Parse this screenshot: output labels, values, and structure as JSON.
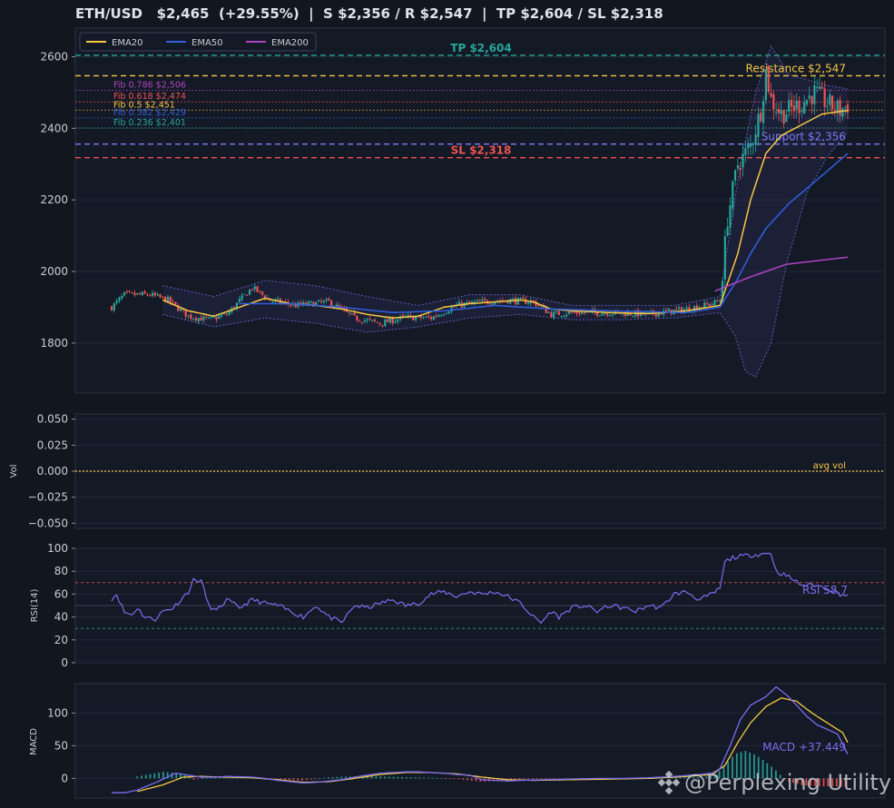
{
  "title": "ETH/USD   $2,465  (+29.55%)  |  S $2,356 / R $2,547  |  TP $2,604 / SL $2,318",
  "watermark": "@Perplexing Utility",
  "colors": {
    "bg": "#12161f",
    "panel": "#141926",
    "grid": "#222939",
    "up": "#26a69a",
    "down": "#ef5350",
    "ema20": "#f5c842",
    "ema50": "#2f5fe0",
    "ema200": "#b044c0",
    "rsi": "#7b6cf0",
    "macd": "#7b6cf0",
    "signal": "#f5c842",
    "text": "#c9ccd2"
  },
  "chart_data": [
    {
      "type": "candlestick",
      "panel": "price",
      "ylim": [
        1660,
        2680
      ],
      "yticks": [
        1800,
        2000,
        2200,
        2400,
        2600
      ],
      "legend": {
        "placement": "top-left",
        "entries": [
          "EMA20",
          "EMA50",
          "EMA200"
        ]
      },
      "levels": [
        {
          "label": "TP $2,604",
          "value": 2604,
          "color": "#26a69a",
          "style": "dash",
          "label_pos": "center"
        },
        {
          "label": "Resistance $2,547",
          "value": 2547,
          "color": "#f5c842",
          "style": "dash",
          "label_pos": "right"
        },
        {
          "label": "Support $2,356",
          "value": 2356,
          "color": "#7b7cf5",
          "style": "dash",
          "label_pos": "right"
        },
        {
          "label": "SL $2,318",
          "value": 2318,
          "color": "#ef5350",
          "style": "dash",
          "label_pos": "center"
        }
      ],
      "fib": [
        {
          "label": "Fib 0.786 $2,506",
          "value": 2506,
          "color": "#b044c0"
        },
        {
          "label": "Fib 0.618 $2,474",
          "value": 2474,
          "color": "#ef5350"
        },
        {
          "label": "Fib 0.5 $2,451",
          "value": 2451,
          "color": "#f5c842"
        },
        {
          "label": "Fib 0.382 $2,429",
          "value": 2429,
          "color": "#2f5fe0"
        },
        {
          "label": "Fib 0.236 $2,401",
          "value": 2401,
          "color": "#26a69a"
        }
      ],
      "close_anchors": [
        [
          0,
          1900
        ],
        [
          5,
          1935
        ],
        [
          15,
          1935
        ],
        [
          22,
          1920
        ],
        [
          30,
          1875
        ],
        [
          38,
          1865
        ],
        [
          45,
          1880
        ],
        [
          55,
          1955
        ],
        [
          62,
          1920
        ],
        [
          72,
          1905
        ],
        [
          85,
          1915
        ],
        [
          95,
          1870
        ],
        [
          105,
          1855
        ],
        [
          115,
          1872
        ],
        [
          125,
          1870
        ],
        [
          135,
          1905
        ],
        [
          145,
          1915
        ],
        [
          155,
          1920
        ],
        [
          165,
          1915
        ],
        [
          172,
          1880
        ],
        [
          180,
          1885
        ],
        [
          195,
          1885
        ],
        [
          210,
          1880
        ],
        [
          225,
          1895
        ],
        [
          235,
          1910
        ],
        [
          238,
          1920
        ],
        [
          241,
          2150
        ],
        [
          245,
          2300
        ],
        [
          250,
          2350
        ],
        [
          254,
          2450
        ],
        [
          256,
          2560
        ],
        [
          258,
          2480
        ],
        [
          262,
          2440
        ],
        [
          270,
          2470
        ],
        [
          275,
          2500
        ],
        [
          280,
          2470
        ],
        [
          285,
          2450
        ],
        [
          288,
          2465
        ]
      ],
      "ema20_anchors": [
        [
          20,
          1920
        ],
        [
          30,
          1890
        ],
        [
          40,
          1875
        ],
        [
          50,
          1900
        ],
        [
          60,
          1925
        ],
        [
          70,
          1910
        ],
        [
          80,
          1905
        ],
        [
          90,
          1895
        ],
        [
          100,
          1880
        ],
        [
          110,
          1870
        ],
        [
          120,
          1875
        ],
        [
          130,
          1900
        ],
        [
          140,
          1910
        ],
        [
          150,
          1915
        ],
        [
          160,
          1920
        ],
        [
          165,
          1915
        ],
        [
          172,
          1895
        ],
        [
          180,
          1890
        ],
        [
          195,
          1885
        ],
        [
          210,
          1882
        ],
        [
          225,
          1890
        ],
        [
          238,
          1905
        ],
        [
          245,
          2050
        ],
        [
          250,
          2200
        ],
        [
          256,
          2330
        ],
        [
          262,
          2380
        ],
        [
          270,
          2410
        ],
        [
          278,
          2440
        ],
        [
          288,
          2450
        ]
      ],
      "ema50_anchors": [
        [
          50,
          1910
        ],
        [
          70,
          1910
        ],
        [
          90,
          1900
        ],
        [
          110,
          1885
        ],
        [
          130,
          1890
        ],
        [
          150,
          1905
        ],
        [
          172,
          1895
        ],
        [
          195,
          1890
        ],
        [
          225,
          1885
        ],
        [
          238,
          1900
        ],
        [
          245,
          1980
        ],
        [
          250,
          2050
        ],
        [
          256,
          2120
        ],
        [
          265,
          2190
        ],
        [
          275,
          2250
        ],
        [
          288,
          2330
        ]
      ],
      "ema200_anchors": [
        [
          236,
          1945
        ],
        [
          250,
          1985
        ],
        [
          264,
          2020
        ],
        [
          288,
          2040
        ]
      ],
      "bb_upper_anchors": [
        [
          20,
          1960
        ],
        [
          40,
          1930
        ],
        [
          60,
          1975
        ],
        [
          80,
          1960
        ],
        [
          100,
          1930
        ],
        [
          120,
          1905
        ],
        [
          140,
          1935
        ],
        [
          160,
          1935
        ],
        [
          180,
          1905
        ],
        [
          200,
          1905
        ],
        [
          220,
          1905
        ],
        [
          238,
          1930
        ],
        [
          246,
          2300
        ],
        [
          252,
          2500
        ],
        [
          258,
          2630
        ],
        [
          265,
          2550
        ],
        [
          280,
          2520
        ],
        [
          288,
          2510
        ]
      ],
      "bb_lower_anchors": [
        [
          20,
          1880
        ],
        [
          40,
          1845
        ],
        [
          60,
          1870
        ],
        [
          80,
          1855
        ],
        [
          100,
          1830
        ],
        [
          120,
          1845
        ],
        [
          140,
          1870
        ],
        [
          160,
          1880
        ],
        [
          180,
          1865
        ],
        [
          200,
          1865
        ],
        [
          220,
          1870
        ],
        [
          238,
          1885
        ],
        [
          244,
          1820
        ],
        [
          248,
          1720
        ],
        [
          252,
          1705
        ],
        [
          258,
          1800
        ],
        [
          264,
          2020
        ],
        [
          272,
          2220
        ],
        [
          280,
          2320
        ],
        [
          288,
          2390
        ]
      ]
    },
    {
      "type": "bar",
      "panel": "volume",
      "ylabel": "Vol",
      "ylim": [
        -0.055,
        0.055
      ],
      "yticks": [
        0.05,
        0.025,
        0,
        -0.025,
        -0.05
      ],
      "ytick_labels": [
        "0.050",
        "0.025",
        "0.000",
        "−0.025",
        "−0.050"
      ],
      "avg_label": "avg vol",
      "avg_value": 0
    },
    {
      "type": "line",
      "panel": "rsi",
      "ylabel": "RSI(14)",
      "ylim": [
        0,
        100
      ],
      "yticks": [
        0,
        20,
        40,
        60,
        80,
        100
      ],
      "overbought": 70,
      "oversold": 30,
      "mid": 50,
      "last_label": "RSI 58.7",
      "anchors": [
        [
          0,
          56
        ],
        [
          2,
          60
        ],
        [
          5,
          44
        ],
        [
          8,
          42
        ],
        [
          10,
          48
        ],
        [
          13,
          40
        ],
        [
          17,
          38
        ],
        [
          20,
          45
        ],
        [
          24,
          48
        ],
        [
          27,
          55
        ],
        [
          30,
          62
        ],
        [
          32,
          72
        ],
        [
          35,
          72
        ],
        [
          38,
          50
        ],
        [
          41,
          45
        ],
        [
          45,
          55
        ],
        [
          50,
          48
        ],
        [
          55,
          55
        ],
        [
          60,
          52
        ],
        [
          65,
          50
        ],
        [
          70,
          45
        ],
        [
          75,
          40
        ],
        [
          80,
          50
        ],
        [
          85,
          40
        ],
        [
          90,
          35
        ],
        [
          95,
          50
        ],
        [
          100,
          48
        ],
        [
          105,
          52
        ],
        [
          110,
          55
        ],
        [
          115,
          50
        ],
        [
          120,
          52
        ],
        [
          125,
          60
        ],
        [
          130,
          62
        ],
        [
          135,
          58
        ],
        [
          140,
          62
        ],
        [
          145,
          60
        ],
        [
          150,
          62
        ],
        [
          155,
          58
        ],
        [
          160,
          52
        ],
        [
          165,
          40
        ],
        [
          168,
          35
        ],
        [
          172,
          45
        ],
        [
          175,
          40
        ],
        [
          180,
          48
        ],
        [
          185,
          50
        ],
        [
          190,
          45
        ],
        [
          195,
          50
        ],
        [
          200,
          48
        ],
        [
          205,
          45
        ],
        [
          210,
          50
        ],
        [
          215,
          48
        ],
        [
          220,
          60
        ],
        [
          225,
          62
        ],
        [
          230,
          55
        ],
        [
          235,
          60
        ],
        [
          238,
          65
        ],
        [
          240,
          88
        ],
        [
          243,
          92
        ],
        [
          250,
          94
        ],
        [
          258,
          96
        ],
        [
          260,
          80
        ],
        [
          265,
          75
        ],
        [
          270,
          68
        ],
        [
          275,
          68
        ],
        [
          280,
          65
        ],
        [
          285,
          60
        ],
        [
          288,
          58.7
        ]
      ]
    },
    {
      "type": "line",
      "panel": "macd",
      "ylabel": "MACD",
      "ylim": [
        -30,
        145
      ],
      "yticks": [
        0,
        50,
        100
      ],
      "last_label": "MACD +37.449",
      "macd_anchors": [
        [
          0,
          -22
        ],
        [
          5,
          -22
        ],
        [
          10,
          -18
        ],
        [
          18,
          -5
        ],
        [
          25,
          8
        ],
        [
          30,
          5
        ],
        [
          35,
          2
        ],
        [
          40,
          2
        ],
        [
          45,
          3
        ],
        [
          55,
          2
        ],
        [
          60,
          0
        ],
        [
          65,
          -3
        ],
        [
          70,
          -5
        ],
        [
          75,
          -7
        ],
        [
          80,
          -6
        ],
        [
          85,
          -4
        ],
        [
          90,
          -2
        ],
        [
          95,
          2
        ],
        [
          100,
          5
        ],
        [
          105,
          8
        ],
        [
          110,
          9
        ],
        [
          115,
          10
        ],
        [
          120,
          10
        ],
        [
          125,
          9
        ],
        [
          130,
          8
        ],
        [
          135,
          6
        ],
        [
          140,
          5
        ],
        [
          145,
          -2
        ],
        [
          150,
          -3
        ],
        [
          155,
          -4
        ],
        [
          160,
          -3
        ],
        [
          170,
          -2
        ],
        [
          180,
          -1
        ],
        [
          190,
          0
        ],
        [
          200,
          0
        ],
        [
          210,
          1
        ],
        [
          220,
          3
        ],
        [
          230,
          6
        ],
        [
          235,
          8
        ],
        [
          238,
          15
        ],
        [
          242,
          50
        ],
        [
          246,
          90
        ],
        [
          250,
          112
        ],
        [
          256,
          125
        ],
        [
          260,
          140
        ],
        [
          264,
          128
        ],
        [
          268,
          112
        ],
        [
          272,
          95
        ],
        [
          276,
          82
        ],
        [
          280,
          75
        ],
        [
          284,
          68
        ],
        [
          288,
          37
        ]
      ],
      "signal_anchors": [
        [
          10,
          -20
        ],
        [
          20,
          -10
        ],
        [
          28,
          2
        ],
        [
          35,
          3
        ],
        [
          45,
          2
        ],
        [
          55,
          1
        ],
        [
          65,
          -2
        ],
        [
          75,
          -6
        ],
        [
          85,
          -5
        ],
        [
          95,
          0
        ],
        [
          105,
          6
        ],
        [
          115,
          9
        ],
        [
          125,
          9
        ],
        [
          135,
          7
        ],
        [
          145,
          2
        ],
        [
          155,
          -2
        ],
        [
          165,
          -3
        ],
        [
          180,
          -2
        ],
        [
          195,
          -1
        ],
        [
          210,
          0
        ],
        [
          225,
          3
        ],
        [
          235,
          6
        ],
        [
          240,
          20
        ],
        [
          245,
          55
        ],
        [
          250,
          85
        ],
        [
          256,
          110
        ],
        [
          262,
          123
        ],
        [
          268,
          118
        ],
        [
          274,
          100
        ],
        [
          280,
          85
        ],
        [
          286,
          70
        ],
        [
          288,
          55
        ]
      ],
      "hist_anchors": [
        [
          10,
          3
        ],
        [
          20,
          10
        ],
        [
          27,
          8
        ],
        [
          32,
          -2
        ],
        [
          38,
          2
        ],
        [
          45,
          1
        ],
        [
          55,
          1
        ],
        [
          65,
          -2
        ],
        [
          75,
          -3
        ],
        [
          85,
          2
        ],
        [
          95,
          3
        ],
        [
          105,
          3
        ],
        [
          115,
          2
        ],
        [
          125,
          1
        ],
        [
          135,
          -1
        ],
        [
          145,
          -5
        ],
        [
          155,
          -3
        ],
        [
          165,
          -1
        ],
        [
          175,
          0
        ],
        [
          185,
          0
        ],
        [
          200,
          -1
        ],
        [
          215,
          1
        ],
        [
          230,
          2
        ],
        [
          236,
          4
        ],
        [
          240,
          20
        ],
        [
          244,
          38
        ],
        [
          248,
          42
        ],
        [
          252,
          36
        ],
        [
          256,
          25
        ],
        [
          260,
          12
        ],
        [
          264,
          -4
        ],
        [
          270,
          -10
        ],
        [
          276,
          -12
        ],
        [
          282,
          -12
        ],
        [
          288,
          -13
        ]
      ]
    }
  ]
}
